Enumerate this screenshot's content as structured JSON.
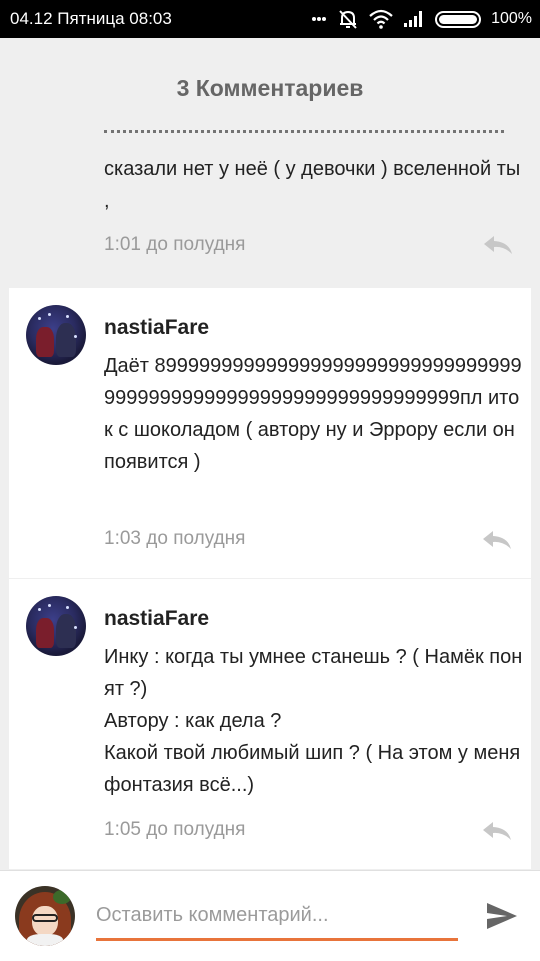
{
  "status_bar": {
    "date_day": "04.12 Пятница",
    "time": "08:03",
    "battery_percent": "100%"
  },
  "header": {
    "title": "3 Комментариев"
  },
  "comments": [
    {
      "text": "сказали нет у неё ( у девочки ) вселенной ты ,",
      "time": "1:01 до полудня"
    },
    {
      "author": "nastiaFare",
      "text": "Даёт 89999999999999999999999999999999999999999999999999999999999999999пл иток с шоколадом ( автору  ну и Эррору если он появится )",
      "time": "1:03 до полудня"
    },
    {
      "author": "nastiaFare",
      "text_lines": [
        "Инку : когда ты умнее станешь ? ( Намёк понят ?)",
        "Автору : как дела ?",
        "Какой твой любимый шип ? ( На этом у меня фонтазия всё...)"
      ],
      "time": "1:05 до полудня"
    }
  ],
  "composer": {
    "placeholder": "Оставить комментарий...",
    "accent_color": "#e8743b"
  },
  "icons": {
    "reply": "reply-icon",
    "send": "send-icon",
    "mute": "bell-off-icon",
    "wifi": "wifi-icon",
    "signal": "signal-icon",
    "battery": "battery-icon"
  }
}
